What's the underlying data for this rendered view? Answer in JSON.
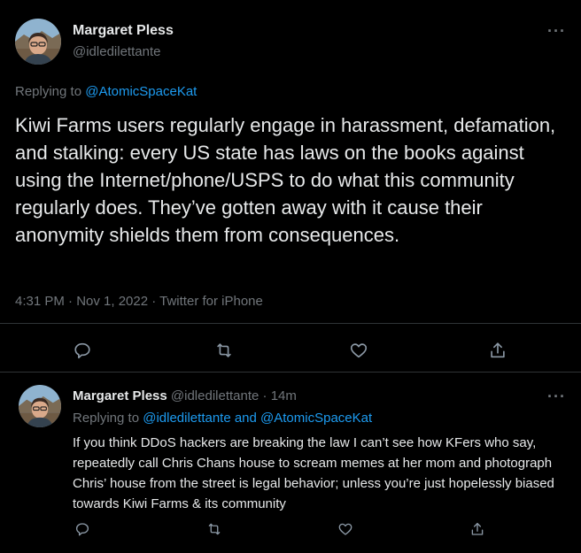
{
  "main_tweet": {
    "author_name": "Margaret Pless",
    "author_handle": "@idledilettante",
    "more_label": "···",
    "replying_prefix": "Replying to ",
    "replying_to": "@AtomicSpaceKat",
    "text": "Kiwi Farms users regularly engage in harassment, defamation, and stalking: every US state has laws on the books against using the Internet/phone/USPS to do what this community regularly does. They’ve gotten away with it cause their anonymity shields them from consequences.",
    "timestamp": "4:31 PM · Nov 1, 2022 · Twitter for iPhone"
  },
  "reply_tweet": {
    "author_name": "Margaret Pless",
    "author_handle": "@idledilettante",
    "age": "· 14m",
    "more_label": "···",
    "replying_prefix": "Replying to ",
    "replying_to": "@idledilettante and @AtomicSpaceKat",
    "text": "If you think DDoS hackers are breaking the law I can’t see how KFers who say, repeatedly call Chris Chans house to scream memes at her mom and photograph Chris’ house from the street is legal behavior; unless you’re just hopelessly biased towards Kiwi Farms & its community"
  },
  "actions": [
    "reply-icon",
    "retweet-icon",
    "like-icon",
    "share-icon"
  ],
  "colors": {
    "background": "#000000",
    "text": "#e7e9ea",
    "muted": "#71767b",
    "link": "#1d9bf0",
    "divider": "#2f3336"
  }
}
